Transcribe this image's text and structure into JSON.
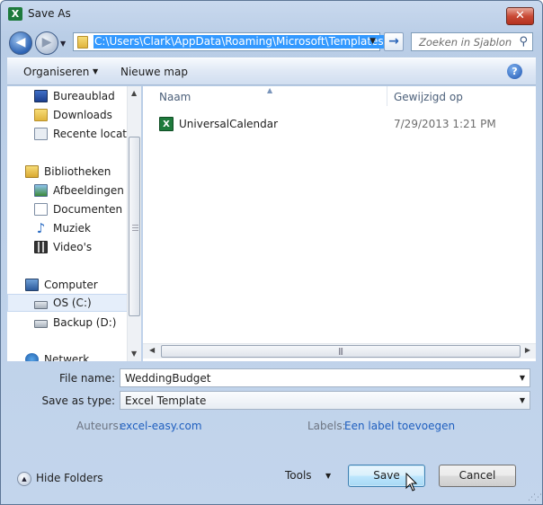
{
  "window": {
    "title": "Save As",
    "app_icon": "excel-icon",
    "close_label": "✕"
  },
  "address": {
    "path": "C:\\Users\\Clark\\AppData\\Roaming\\Microsoft\\Templates",
    "search_placeholder": "Zoeken in Sjablon"
  },
  "toolbar": {
    "organise_label": "Organiseren",
    "new_folder_label": "Nieuwe map",
    "help_label": "?"
  },
  "sidebar": {
    "items": [
      {
        "label": "Bureaublad",
        "icon": "desktop-icon"
      },
      {
        "label": "Downloads",
        "icon": "downloads-folder-icon"
      },
      {
        "label": "Recente locatie",
        "icon": "recent-places-icon"
      },
      {
        "label": "Bibliotheken",
        "icon": "libraries-icon"
      },
      {
        "label": "Afbeeldingen",
        "icon": "pictures-icon"
      },
      {
        "label": "Documenten",
        "icon": "documents-icon"
      },
      {
        "label": "Muziek",
        "icon": "music-icon"
      },
      {
        "label": "Video's",
        "icon": "videos-icon"
      },
      {
        "label": "Computer",
        "icon": "computer-icon"
      },
      {
        "label": "OS (C:)",
        "icon": "drive-icon",
        "selected": true
      },
      {
        "label": "Backup (D:)",
        "icon": "drive-icon"
      },
      {
        "label": "Netwerk",
        "icon": "network-icon"
      }
    ]
  },
  "files": {
    "columns": [
      "Naam",
      "Gewijzigd op"
    ],
    "rows": [
      {
        "name": "UniversalCalendar",
        "modified": "7/29/2013 1:21 PM",
        "icon": "excel-template-icon"
      }
    ]
  },
  "form": {
    "filename_label": "File name:",
    "filename_value": "WeddingBudget",
    "savetype_label": "Save as type:",
    "savetype_value": "Excel Template",
    "authors_label": "Auteurs:",
    "authors_value": "excel-easy.com",
    "tags_label": "Labels:",
    "tags_value": "Een label toevoegen"
  },
  "footer": {
    "hide_folders_label": "Hide Folders",
    "tools_label": "Tools",
    "save_label": "Save",
    "cancel_label": "Cancel"
  },
  "colors": {
    "selection": "#3399ff",
    "link": "#1f5fbf",
    "frame": "#c3d5ec"
  }
}
